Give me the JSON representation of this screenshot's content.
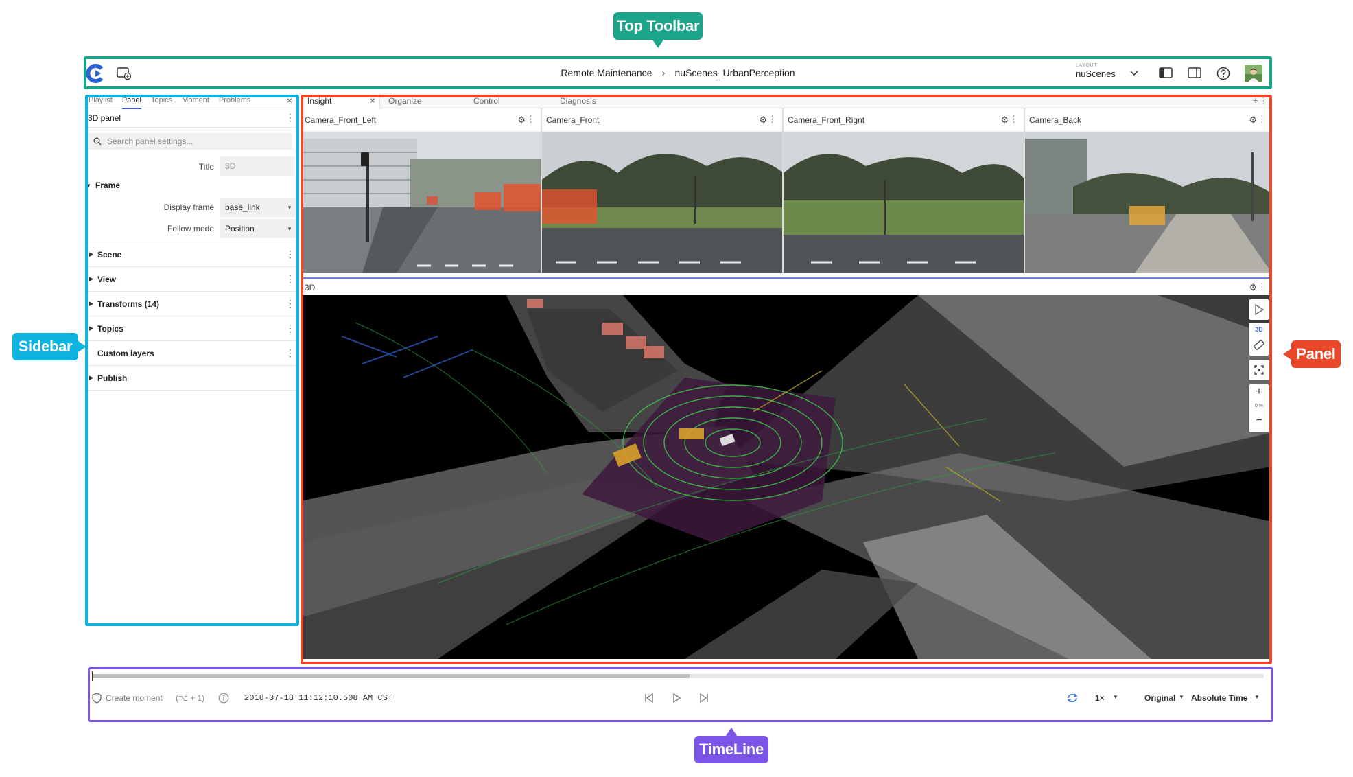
{
  "annotations": {
    "top_toolbar": {
      "label": "Top Toolbar",
      "color": "#1aa58a"
    },
    "sidebar": {
      "label": "Sidebar",
      "color": "#0fb3e0"
    },
    "panel": {
      "label": "Panel",
      "color": "#e8472a"
    },
    "timeline": {
      "label": "TimeLine",
      "color": "#7a55e8"
    }
  },
  "toolbar": {
    "breadcrumb": [
      "Remote Maintenance",
      "nuScenes_UrbanPerception"
    ],
    "breadcrumb_sep": "›",
    "layout_label": "LAYOUT",
    "layout_value": "nuScenes"
  },
  "sidebar": {
    "tabs": [
      "Playlist",
      "Panel",
      "Topics",
      "Moment",
      "Problems"
    ],
    "active_tab": "Panel",
    "close": "×",
    "panel_title": "3D panel",
    "search_placeholder": "Search panel settings...",
    "title_label": "Title",
    "title_value": "3D",
    "frame_section": "Frame",
    "display_frame_label": "Display frame",
    "display_frame_value": "base_link",
    "follow_mode_label": "Follow mode",
    "follow_mode_value": "Position",
    "sections": [
      "Scene",
      "View",
      "Transforms (14)",
      "Topics",
      "Custom layers",
      "Publish"
    ]
  },
  "main": {
    "tabs": [
      "Insight",
      "Organize",
      "Control",
      "Diagnosis"
    ],
    "active_tab": "Insight",
    "cameras": [
      "Camera_Front_Left",
      "Camera_Front",
      "Camera_Front_Rignt",
      "Camera_Back"
    ],
    "view3d_title": "3D",
    "tool_3d_label": "3D",
    "zoom_value": "0 %"
  },
  "timeline": {
    "progress": 0.51,
    "create_moment": "Create moment",
    "shortcut": "(⌥ + 1)",
    "timestamp": "2018-07-18 11:12:10.508 AM CST",
    "speed": "1×",
    "mode": "Original",
    "time_format": "Absolute Time"
  }
}
